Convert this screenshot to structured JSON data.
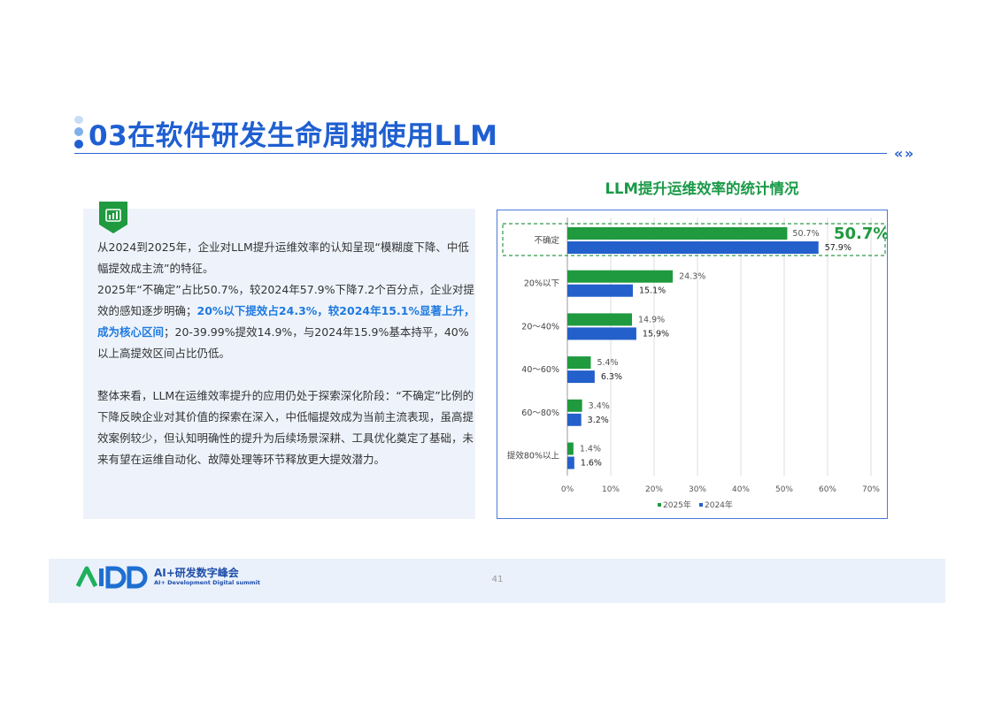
{
  "header": {
    "title": "03在软件研发生命周期使用LLM",
    "nav_icon": "double-chevron-icons"
  },
  "body": {
    "icon": "bar-chart-icon",
    "p1": "从2024到2025年，企业对LLM提升运维效率的认知呈现“模糊度下降、中低幅提效成主流”的特征。",
    "p2_a": "2025年“不确定”占比50.7%，较2024年57.9%下降7.2个百分点，企业对提效的感知逐步明确；",
    "p2_highlight": "20%以下提效占24.3%，较2024年15.1%显著上升，成为核心区间",
    "p2_b": "；20-39.99%提效14.9%，与2024年15.9%基本持平，40%以上高提效区间占比仍低。",
    "p3": "整体来看，LLM在运维效率提升的应用仍处于探索深化阶段：“不确定”比例的下降反映企业对其价值的探索在深入，中低幅提效成为当前主流表现，虽高提效案例较少，但认知明确性的提升为后续场景深耕、工具优化奠定了基础，未来有望在运维自动化、故障处理等环节释放更大提效潜力。"
  },
  "chart_data": {
    "type": "bar",
    "orientation": "horizontal",
    "title": "LLM提升运维效率的统计情况",
    "categories": [
      "不确定",
      "20%以下",
      "20～40%",
      "40～60%",
      "60～80%",
      "提效80%以上"
    ],
    "series": [
      {
        "name": "2025年",
        "values": [
          50.7,
          24.3,
          14.9,
          5.4,
          3.4,
          1.4
        ],
        "labels": [
          "50.7%",
          "24.3%",
          "14.9%",
          "5.4%",
          "3.4%",
          "1.4%"
        ],
        "color": "#1f9a3f"
      },
      {
        "name": "2024年",
        "values": [
          57.9,
          15.1,
          15.9,
          6.3,
          3.2,
          1.6
        ],
        "labels": [
          "57.9%",
          "15.1%",
          "15.9%",
          "6.3%",
          "3.2%",
          "1.6%"
        ],
        "color": "#2460cc"
      }
    ],
    "xlim": [
      0,
      70
    ],
    "xticks": [
      "0%",
      "10%",
      "20%",
      "30%",
      "40%",
      "50%",
      "60%",
      "70%"
    ],
    "grid": true,
    "legend_position": "bottom",
    "annotation": {
      "text": "50.7%",
      "color": "#1f9a3f",
      "target_category": "不确定"
    }
  },
  "footer": {
    "brand": "AI+研发数字峰会",
    "brand_sub": "AI+ Development Digital summit",
    "page": "41"
  }
}
